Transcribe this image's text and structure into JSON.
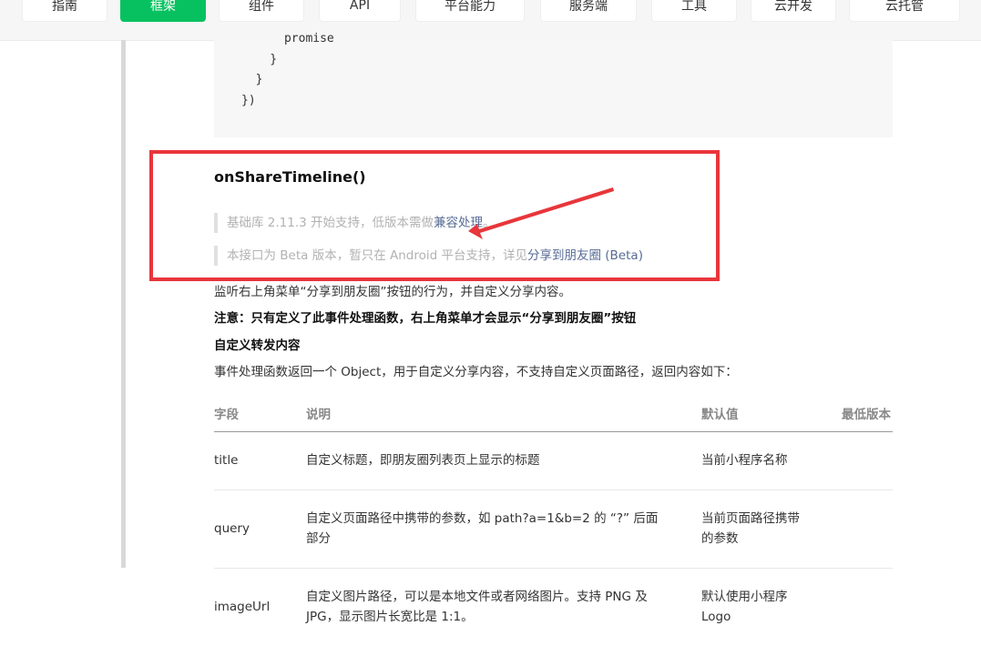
{
  "nav": {
    "tabs": [
      {
        "label": "指南",
        "active": false
      },
      {
        "label": "框架",
        "active": true
      },
      {
        "label": "组件",
        "active": false
      },
      {
        "label": "API",
        "active": false
      },
      {
        "label": "平台能力",
        "active": false
      },
      {
        "label": "服务端",
        "active": false
      },
      {
        "label": "工具",
        "active": false
      },
      {
        "label": "云开发",
        "active": false
      },
      {
        "label": "云托管",
        "active": false
      }
    ]
  },
  "code": {
    "lines": [
      "      promise",
      "    }",
      "  }",
      "})"
    ]
  },
  "section": {
    "title": "onShareTimeline()",
    "note1_prefix": "基础库 2.11.3 开始支持，低版本需做",
    "note1_link": "兼容处理",
    "note1_suffix": "。",
    "note2_prefix": "本接口为 Beta 版本，暂只在 Android 平台支持，详见",
    "note2_link": "分享到朋友圈 (Beta)"
  },
  "body": {
    "desc": "监听右上角菜单“分享到朋友圈”按钮的行为，并自定义分享内容。",
    "warning": "注意：只有定义了此事件处理函数，右上角菜单才会显示“分享到朋友圈”按钮",
    "subheading": "自定义转发内容",
    "intro": "事件处理函数返回一个 Object，用于自定义分享内容，不支持自定义页面路径，返回内容如下："
  },
  "table": {
    "headers": [
      "字段",
      "说明",
      "默认值",
      "最低版本"
    ],
    "rows": [
      {
        "field": "title",
        "desc_l1": "自定义标题，即朋友圈列表页上显示的标题",
        "desc_l2": "",
        "default_l1": "当前小程序名称",
        "default_l2": "",
        "version": ""
      },
      {
        "field": "query",
        "desc_l1": "自定义页面路径中携带的参数，如 path?a=1&b=2 的 “?” 后面",
        "desc_l2": "部分",
        "default_l1": "当前页面路径携带",
        "default_l2": "的参数",
        "version": ""
      },
      {
        "field": "imageUrl",
        "desc_l1": "自定义图片路径，可以是本地文件或者网络图片。支持 PNG 及",
        "desc_l2": "JPG，显示图片长宽比是 1:1。",
        "default_l1": "默认使用小程序",
        "default_l2": "Logo",
        "version": ""
      }
    ]
  },
  "colors": {
    "accent": "#07c160",
    "highlight_box": "#e8363b",
    "link": "#576b95"
  }
}
